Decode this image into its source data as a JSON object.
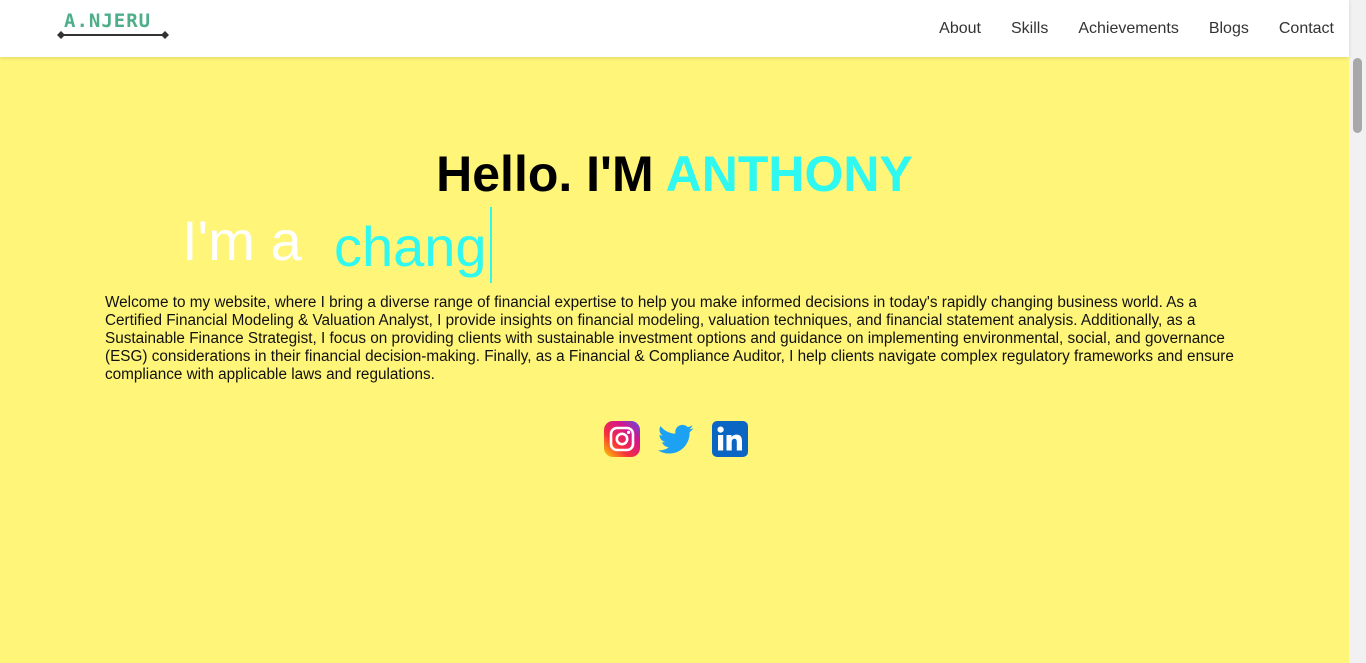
{
  "logo": {
    "text": "A.NJERU",
    "color": "#4fae8a"
  },
  "nav": {
    "items": [
      {
        "label": "About"
      },
      {
        "label": "Skills"
      },
      {
        "label": "Achievements"
      },
      {
        "label": "Blogs"
      },
      {
        "label": "Contact"
      }
    ]
  },
  "hero": {
    "greeting": "Hello. I'M ",
    "name": "ANTHONY",
    "typing_prefix": "I'm a",
    "typing_word": "chang",
    "intro": "Welcome to my website, where I bring a diverse range of financial expertise to help you make informed decisions in today's rapidly changing business world. As a Certified Financial Modeling & Valuation Analyst, I provide insights on financial modeling, valuation techniques, and financial statement analysis. Additionally, as a Sustainable Finance Strategist, I focus on providing clients with sustainable investment options and guidance on implementing environmental, social, and governance (ESG) considerations in their financial decision-making. Finally, as a Financial & Compliance Auditor, I help clients navigate complex regulatory frameworks and ensure compliance with applicable laws and regulations."
  },
  "socials": [
    {
      "icon": "instagram-icon"
    },
    {
      "icon": "twitter-icon"
    },
    {
      "icon": "linkedin-icon"
    }
  ],
  "colors": {
    "background": "#fef579",
    "accent": "#2ef8f0",
    "header": "#ffffff"
  }
}
